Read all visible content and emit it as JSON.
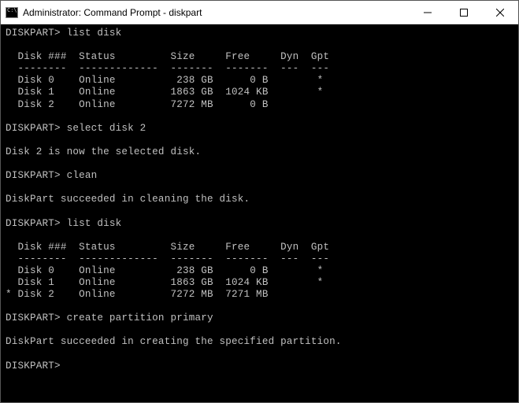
{
  "window": {
    "title": "Administrator: Command Prompt - diskpart",
    "icon_glyph": "C:\\."
  },
  "prompt": "DISKPART>",
  "session": {
    "cmd1": "list disk",
    "table1": {
      "header": "  Disk ###  Status         Size     Free     Dyn  Gpt",
      "divider": "  --------  -------------  -------  -------  ---  ---",
      "rows": [
        "  Disk 0    Online          238 GB      0 B        *",
        "  Disk 1    Online         1863 GB  1024 KB        *",
        "  Disk 2    Online         7272 MB      0 B"
      ]
    },
    "cmd2": "select disk 2",
    "response2": "Disk 2 is now the selected disk.",
    "cmd3": "clean",
    "response3": "DiskPart succeeded in cleaning the disk.",
    "cmd4": "list disk",
    "table2": {
      "header": "  Disk ###  Status         Size     Free     Dyn  Gpt",
      "divider": "  --------  -------------  -------  -------  ---  ---",
      "rows": [
        "  Disk 0    Online          238 GB      0 B        *",
        "  Disk 1    Online         1863 GB  1024 KB        *",
        "* Disk 2    Online         7272 MB  7271 MB"
      ]
    },
    "cmd5": "create partition primary",
    "response5": "DiskPart succeeded in creating the specified partition.",
    "cmd6": ""
  }
}
